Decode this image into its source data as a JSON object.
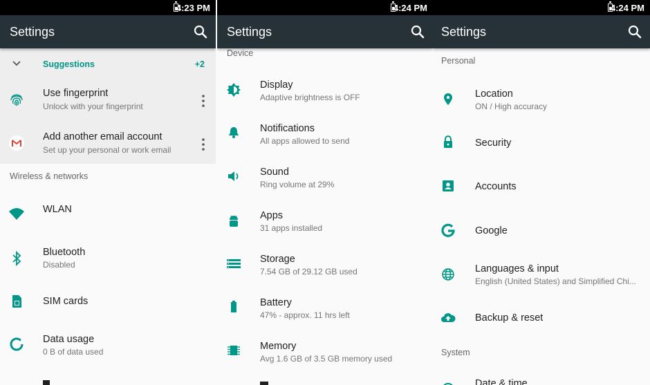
{
  "panels": [
    {
      "time": "4:23 PM",
      "title": "Settings",
      "suggestions": {
        "label": "Suggestions",
        "count": "+2",
        "items": [
          {
            "title": "Use fingerprint",
            "subtitle": "Unlock with your fingerprint",
            "icon": "fingerprint-icon"
          },
          {
            "title": "Add another email account",
            "subtitle": "Set up your personal or work email",
            "icon": "gmail-icon"
          }
        ]
      },
      "section": "Wireless & networks",
      "items": [
        {
          "title": "WLAN",
          "subtitle": "",
          "icon": "wifi-icon"
        },
        {
          "title": "Bluetooth",
          "subtitle": "Disabled",
          "icon": "bluetooth-icon"
        },
        {
          "title": "SIM cards",
          "subtitle": "",
          "icon": "sim-card-icon"
        },
        {
          "title": "Data usage",
          "subtitle": "0 B of data used",
          "icon": "data-usage-icon"
        }
      ]
    },
    {
      "time": "4:24 PM",
      "title": "Settings",
      "section": "Device",
      "items": [
        {
          "title": "Display",
          "subtitle": "Adaptive brightness is OFF",
          "icon": "brightness-icon"
        },
        {
          "title": "Notifications",
          "subtitle": "All apps allowed to send",
          "icon": "bell-icon"
        },
        {
          "title": "Sound",
          "subtitle": "Ring volume at 29%",
          "icon": "volume-icon"
        },
        {
          "title": "Apps",
          "subtitle": "31 apps installed",
          "icon": "android-icon"
        },
        {
          "title": "Storage",
          "subtitle": "7.54 GB of 29.12 GB used",
          "icon": "storage-icon"
        },
        {
          "title": "Battery",
          "subtitle": "47% - approx. 11 hrs left",
          "icon": "battery-icon"
        },
        {
          "title": "Memory",
          "subtitle": "Avg 1.6 GB of 3.5 GB memory used",
          "icon": "memory-icon"
        }
      ]
    },
    {
      "time": "4:24 PM",
      "title": "Settings",
      "section": "Personal",
      "items": [
        {
          "title": "Location",
          "subtitle": "ON / High accuracy",
          "icon": "location-icon"
        },
        {
          "title": "Security",
          "subtitle": "",
          "icon": "lock-icon"
        },
        {
          "title": "Accounts",
          "subtitle": "",
          "icon": "account-icon"
        },
        {
          "title": "Google",
          "subtitle": "",
          "icon": "google-icon"
        },
        {
          "title": "Languages & input",
          "subtitle": "English (United States) and Simplified Chi...",
          "icon": "globe-icon"
        },
        {
          "title": "Backup & reset",
          "subtitle": "",
          "icon": "cloud-upload-icon"
        }
      ],
      "section2": "System",
      "partial": "Date & time"
    }
  ],
  "colors": {
    "accent": "#009688",
    "toolbar": "#263238",
    "status_bar": "#000000"
  }
}
